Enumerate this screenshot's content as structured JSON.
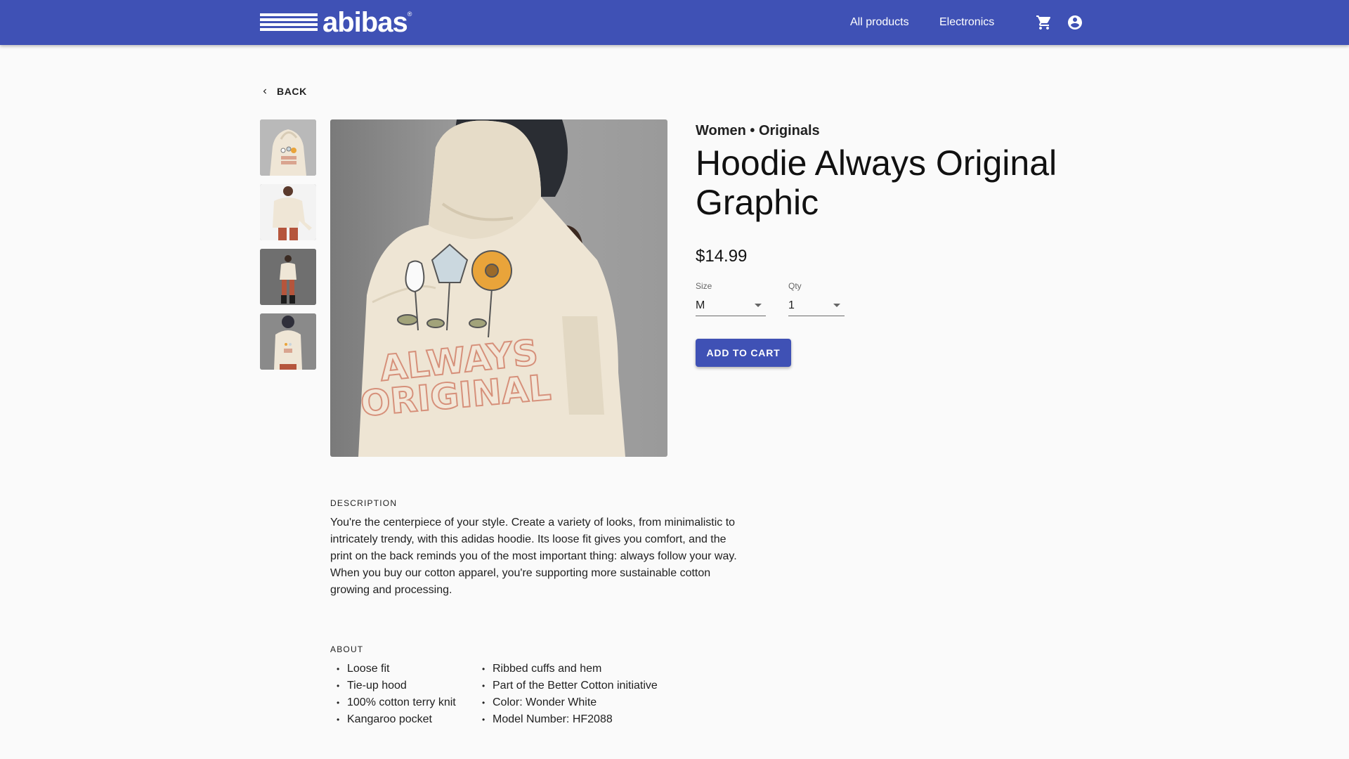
{
  "brand": {
    "name": "abibas",
    "reg": "®"
  },
  "nav": {
    "links": [
      "All products",
      "Electronics"
    ],
    "cart_icon": "shopping-cart-icon",
    "account_icon": "account-circle-icon"
  },
  "back": {
    "label": "BACK",
    "icon": "chevron-left-icon"
  },
  "gallery": {
    "thumbnails": [
      "hoodie-back-view",
      "hoodie-front-view",
      "full-body-front-view",
      "full-body-back-view"
    ],
    "main_image": "hoodie-back-view"
  },
  "product": {
    "category": "Women • Originals",
    "title": "Hoodie Always Original Graphic",
    "price": "$14.99",
    "graphic_text_line1": "ALWAYS",
    "graphic_text_line2": "ORIGINAL"
  },
  "size": {
    "label": "Size",
    "value": "M"
  },
  "qty": {
    "label": "Qty",
    "value": "1"
  },
  "add_to_cart": {
    "label": "ADD TO CART"
  },
  "description": {
    "heading": "DESCRIPTION",
    "paragraph1": "You're the centerpiece of your style. Create a variety of looks, from minimalistic to intricately trendy, with this adidas hoodie. Its loose fit gives you comfort, and the print on the back reminds you of the most important thing: always follow your way.",
    "paragraph2": "When you buy our cotton apparel, you're supporting more sustainable cotton growing and processing."
  },
  "about": {
    "heading": "ABOUT",
    "col1": [
      "Loose fit",
      "Tie-up hood",
      "100% cotton terry knit",
      "Kangaroo pocket"
    ],
    "col2": [
      "Ribbed cuffs and hem",
      "Part of the Better Cotton initiative",
      "Color: Wonder White",
      "Model Number: HF2088"
    ]
  },
  "colors": {
    "primary": "#3f51b5",
    "background": "#fafafa",
    "hoodie": "#efe6d6"
  }
}
